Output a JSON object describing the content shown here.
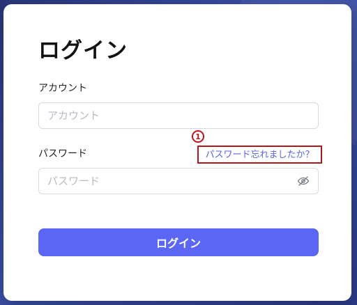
{
  "page": {
    "title": "ログイン"
  },
  "form": {
    "account": {
      "label": "アカウント",
      "placeholder": "アカウント"
    },
    "password": {
      "label": "パスワード",
      "placeholder": "パスワード",
      "toggle_icon": "eye-off-icon"
    },
    "forgot_password": {
      "marker": "1",
      "label": "パスワード忘れましたか？"
    },
    "submit": {
      "label": "ログイン"
    }
  },
  "colors": {
    "background": "#2f3e8a",
    "primary": "#5b67f4",
    "link": "#5a63e8",
    "annotation": "#c0141b"
  }
}
